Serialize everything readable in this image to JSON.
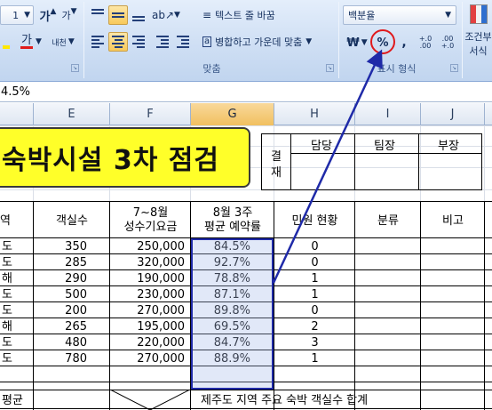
{
  "ribbon": {
    "font_size_value": "1",
    "bold_glyph": "가",
    "font_color_glyph": "가",
    "phonetic_label": "내천",
    "wrap_text_label": "텍스트 줄 바꿈",
    "merge_center_label": "병합하고 가운데 맞춤",
    "alignment_group_label": "맞춤",
    "number_format_value": "백분율",
    "currency_glyph": "₩",
    "percent_glyph": "%",
    "comma_glyph": ",",
    "inc_decimal_label": "+.0 .00",
    "dec_decimal_label": ".00 +.0",
    "number_group_label": "표시 형식",
    "conditional_label_1": "조건부",
    "conditional_label_2": "서식"
  },
  "formula_bar": {
    "value": "4.5%"
  },
  "columns": [
    "E",
    "F",
    "G",
    "H",
    "I",
    "J"
  ],
  "title": "숙박시설 3차 점검",
  "approval": {
    "side_label_1": "결",
    "side_label_2": "재",
    "headers": [
      "담당",
      "팀장",
      "부장"
    ]
  },
  "table": {
    "headers": {
      "col_d": "역",
      "rooms": "객실수",
      "peak_price_1": "7~8월",
      "peak_price_2": "성수기요금",
      "occupancy_1": "8월 3주",
      "occupancy_2": "평균 예약률",
      "complaints": "민원 현황",
      "category": "분류",
      "notes": "비고"
    },
    "rows": [
      {
        "d": "도",
        "rooms": "350",
        "price": "250,000",
        "occ": "84.5%",
        "comp": "0"
      },
      {
        "d": "도",
        "rooms": "285",
        "price": "320,000",
        "occ": "92.7%",
        "comp": "0"
      },
      {
        "d": "해",
        "rooms": "290",
        "price": "190,000",
        "occ": "78.8%",
        "comp": "1"
      },
      {
        "d": "도",
        "rooms": "500",
        "price": "230,000",
        "occ": "87.1%",
        "comp": "1"
      },
      {
        "d": "도",
        "rooms": "200",
        "price": "270,000",
        "occ": "89.8%",
        "comp": "0"
      },
      {
        "d": "해",
        "rooms": "265",
        "price": "195,000",
        "occ": "69.5%",
        "comp": "2"
      },
      {
        "d": "도",
        "rooms": "480",
        "price": "220,000",
        "occ": "84.7%",
        "comp": "3"
      },
      {
        "d": "도",
        "rooms": "780",
        "price": "270,000",
        "occ": "88.9%",
        "comp": "1"
      }
    ],
    "footer_left": "평균",
    "footer_right": "제주도 지역 주요 숙박 객실수 합계"
  },
  "colors": {
    "title_fill": "#ffff29",
    "selection_border": "#1f2aa8",
    "highlight_ring": "#e0191c",
    "arrow": "#1f2aa8"
  }
}
